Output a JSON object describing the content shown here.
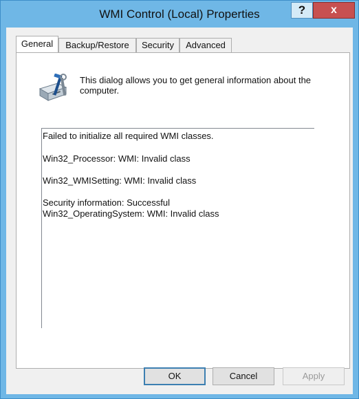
{
  "window": {
    "title": "WMI Control (Local) Properties",
    "help_label": "?",
    "close_label": "x"
  },
  "tabs": [
    {
      "label": "General",
      "active": true
    },
    {
      "label": "Backup/Restore",
      "active": false
    },
    {
      "label": "Security",
      "active": false
    },
    {
      "label": "Advanced",
      "active": false
    }
  ],
  "general": {
    "icon": "computer-tools-icon",
    "intro": "This dialog allows you to get general information about the computer.",
    "status_lines": [
      "Failed to initialize all required WMI classes.",
      "Win32_Processor: WMI: Invalid class",
      "Win32_WMISetting: WMI: Invalid class",
      "Security information: Successful",
      "Win32_OperatingSystem: WMI: Invalid class"
    ]
  },
  "buttons": {
    "ok": "OK",
    "cancel": "Cancel",
    "apply": "Apply"
  },
  "colors": {
    "titlebar": "#6fb7e6",
    "close": "#c75050",
    "default_button_border": "#3c7fb1"
  }
}
